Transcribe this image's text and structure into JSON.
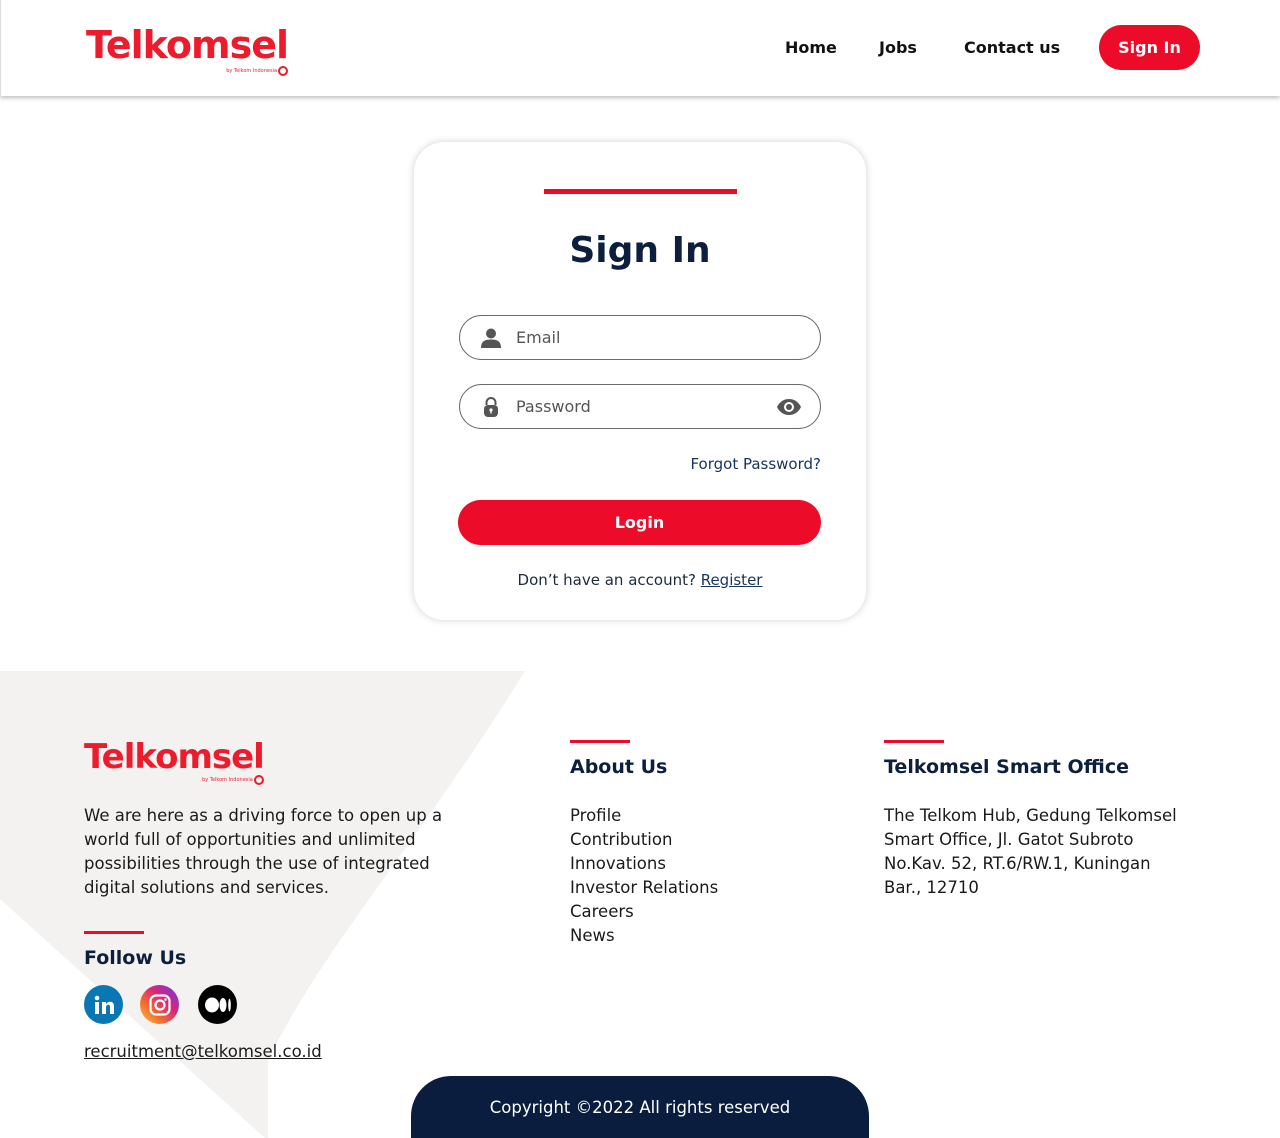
{
  "brand": {
    "name": "Telkomsel",
    "tagline": "by Telkom Indonesia",
    "primary_color": "#ec0b29",
    "navy_color": "#0a1d3e"
  },
  "header": {
    "nav": {
      "home": "Home",
      "jobs": "Jobs",
      "contact": "Contact us"
    },
    "signin_label": "Sign In"
  },
  "login": {
    "title": "Sign In",
    "email_placeholder": "Email",
    "password_placeholder": "Password",
    "forgot_label": "Forgot Password?",
    "login_label": "Login",
    "no_account_text": "Don’t have an account? ",
    "register_label": "Register",
    "icons": {
      "email": "user-icon",
      "password": "lock-icon",
      "toggle": "eye-icon"
    }
  },
  "footer": {
    "description": "We are here as a driving force to open up a world full of opportunities and unlimited possibilities through the use of integrated digital solutions and services.",
    "follow_title": "Follow Us",
    "social": {
      "linkedin": "linkedin-icon",
      "instagram": "instagram-icon",
      "medium": "medium-icon"
    },
    "email": "recruitment@telkomsel.co.id ",
    "about": {
      "title": "About Us",
      "items": [
        "Profile",
        "Contribution",
        "Innovations",
        "Investor Relations",
        "Careers",
        "News"
      ]
    },
    "office": {
      "title": "Telkomsel Smart Office",
      "address": "The Telkom Hub, Gedung Telkomsel Smart Office, Jl. Gatot Subroto No.Kav. 52, RT.6/RW.1, Kuningan Bar., 12710"
    },
    "copyright": "Copyright ©2022 All rights reserved"
  }
}
